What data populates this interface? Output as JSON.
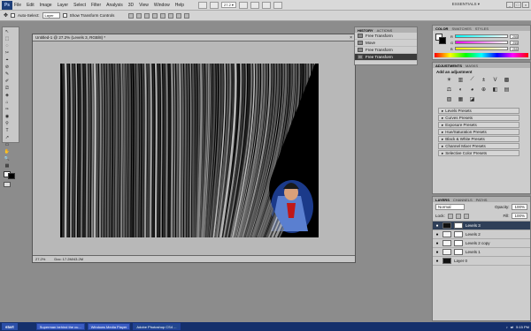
{
  "app": {
    "logo_text": "Ps",
    "workspace": "ESSENTIALS ▾",
    "menu": [
      "File",
      "Edit",
      "Image",
      "Layer",
      "Select",
      "Filter",
      "Analysis",
      "3D",
      "View",
      "Window",
      "Help"
    ],
    "zoom_value": "27.2 ▾"
  },
  "options": {
    "auto_select_label": "Auto-Select:",
    "auto_select_value": "Layer",
    "transform_label": "Show Transform Controls"
  },
  "document": {
    "title": "Untitled-1 @ 27.2% (Levels 3, RGB/8) *",
    "status_zoom": "27.2%",
    "status_doc": "Doc: 17.2M/43.2M"
  },
  "history": {
    "tabs": [
      "HISTORY",
      "ACTIONS"
    ],
    "items": [
      "Free Transform",
      "Move",
      "Free Transform",
      "Free Transform"
    ]
  },
  "color": {
    "tabs": [
      "COLOR",
      "SWATCHES",
      "STYLES"
    ],
    "channels": [
      {
        "name": "R",
        "value": "255"
      },
      {
        "name": "G",
        "value": "255"
      },
      {
        "name": "B",
        "value": "255"
      }
    ]
  },
  "adjustments": {
    "tabs": [
      "ADJUSTMENTS",
      "MASKS"
    ],
    "heading": "Add an adjustment",
    "icon_names": [
      "brightness-icon",
      "levels-icon",
      "curves-icon",
      "exposure-icon",
      "vibrance-icon",
      "hue-sat-icon",
      "color-balance-icon",
      "bw-icon",
      "photo-filter-icon",
      "channel-mixer-icon",
      "invert-icon",
      "posterize-icon",
      "threshold-icon",
      "gradient-map-icon",
      "selective-color-icon"
    ],
    "icon_glyphs": [
      "☀",
      "▥",
      "⟋",
      "±",
      "V",
      "▩",
      "⚖",
      "◐",
      "◕",
      "⊕",
      "◧",
      "▤",
      "▨",
      "▦",
      "◪"
    ],
    "presets": [
      "Levels Presets",
      "Curves Presets",
      "Exposure Presets",
      "Hue/Saturation Presets",
      "Black & White Presets",
      "Channel Mixer Presets",
      "Selective Color Presets"
    ]
  },
  "layers": {
    "tabs": [
      "LAYERS",
      "CHANNELS",
      "PATHS"
    ],
    "blend_mode": "Normal",
    "opacity_label": "Opacity:",
    "opacity_value": "100%",
    "lock_label": "Lock:",
    "fill_label": "Fill:",
    "fill_value": "100%",
    "items": [
      {
        "name": "Levels 3",
        "selected": true,
        "dark": true
      },
      {
        "name": "Levels 2",
        "selected": false,
        "dark": false
      },
      {
        "name": "Levels 2 copy",
        "selected": false,
        "dark": false
      },
      {
        "name": "Levels 1",
        "selected": false,
        "dark": false
      },
      {
        "name": "Layer 0",
        "selected": false,
        "dark": true
      }
    ]
  },
  "taskbar": {
    "start": "start",
    "tasks": [
      {
        "label": "Superman behind the cu...",
        "active": false
      },
      {
        "label": "Windows Media Player",
        "active": false
      },
      {
        "label": "Adobe Photoshop CS4 ...",
        "active": true
      }
    ],
    "clock": "5:15 PM"
  },
  "tool_glyphs": [
    "↖",
    "⬚",
    "◌",
    "✂",
    "⌖",
    "⊘",
    "✎",
    "✐",
    "⎚",
    "◈",
    "⌂",
    "✑",
    "◉",
    "⚲",
    "T",
    "↗",
    "▭",
    "✋",
    "🔍",
    "▦"
  ],
  "colors": {
    "menu_bg": "#d9d9d9",
    "panel_bg": "#cdcdcd",
    "workspace_bg": "#8c8c8c",
    "selected_layer": "#2f3f58",
    "taskbar": "#15306c"
  }
}
